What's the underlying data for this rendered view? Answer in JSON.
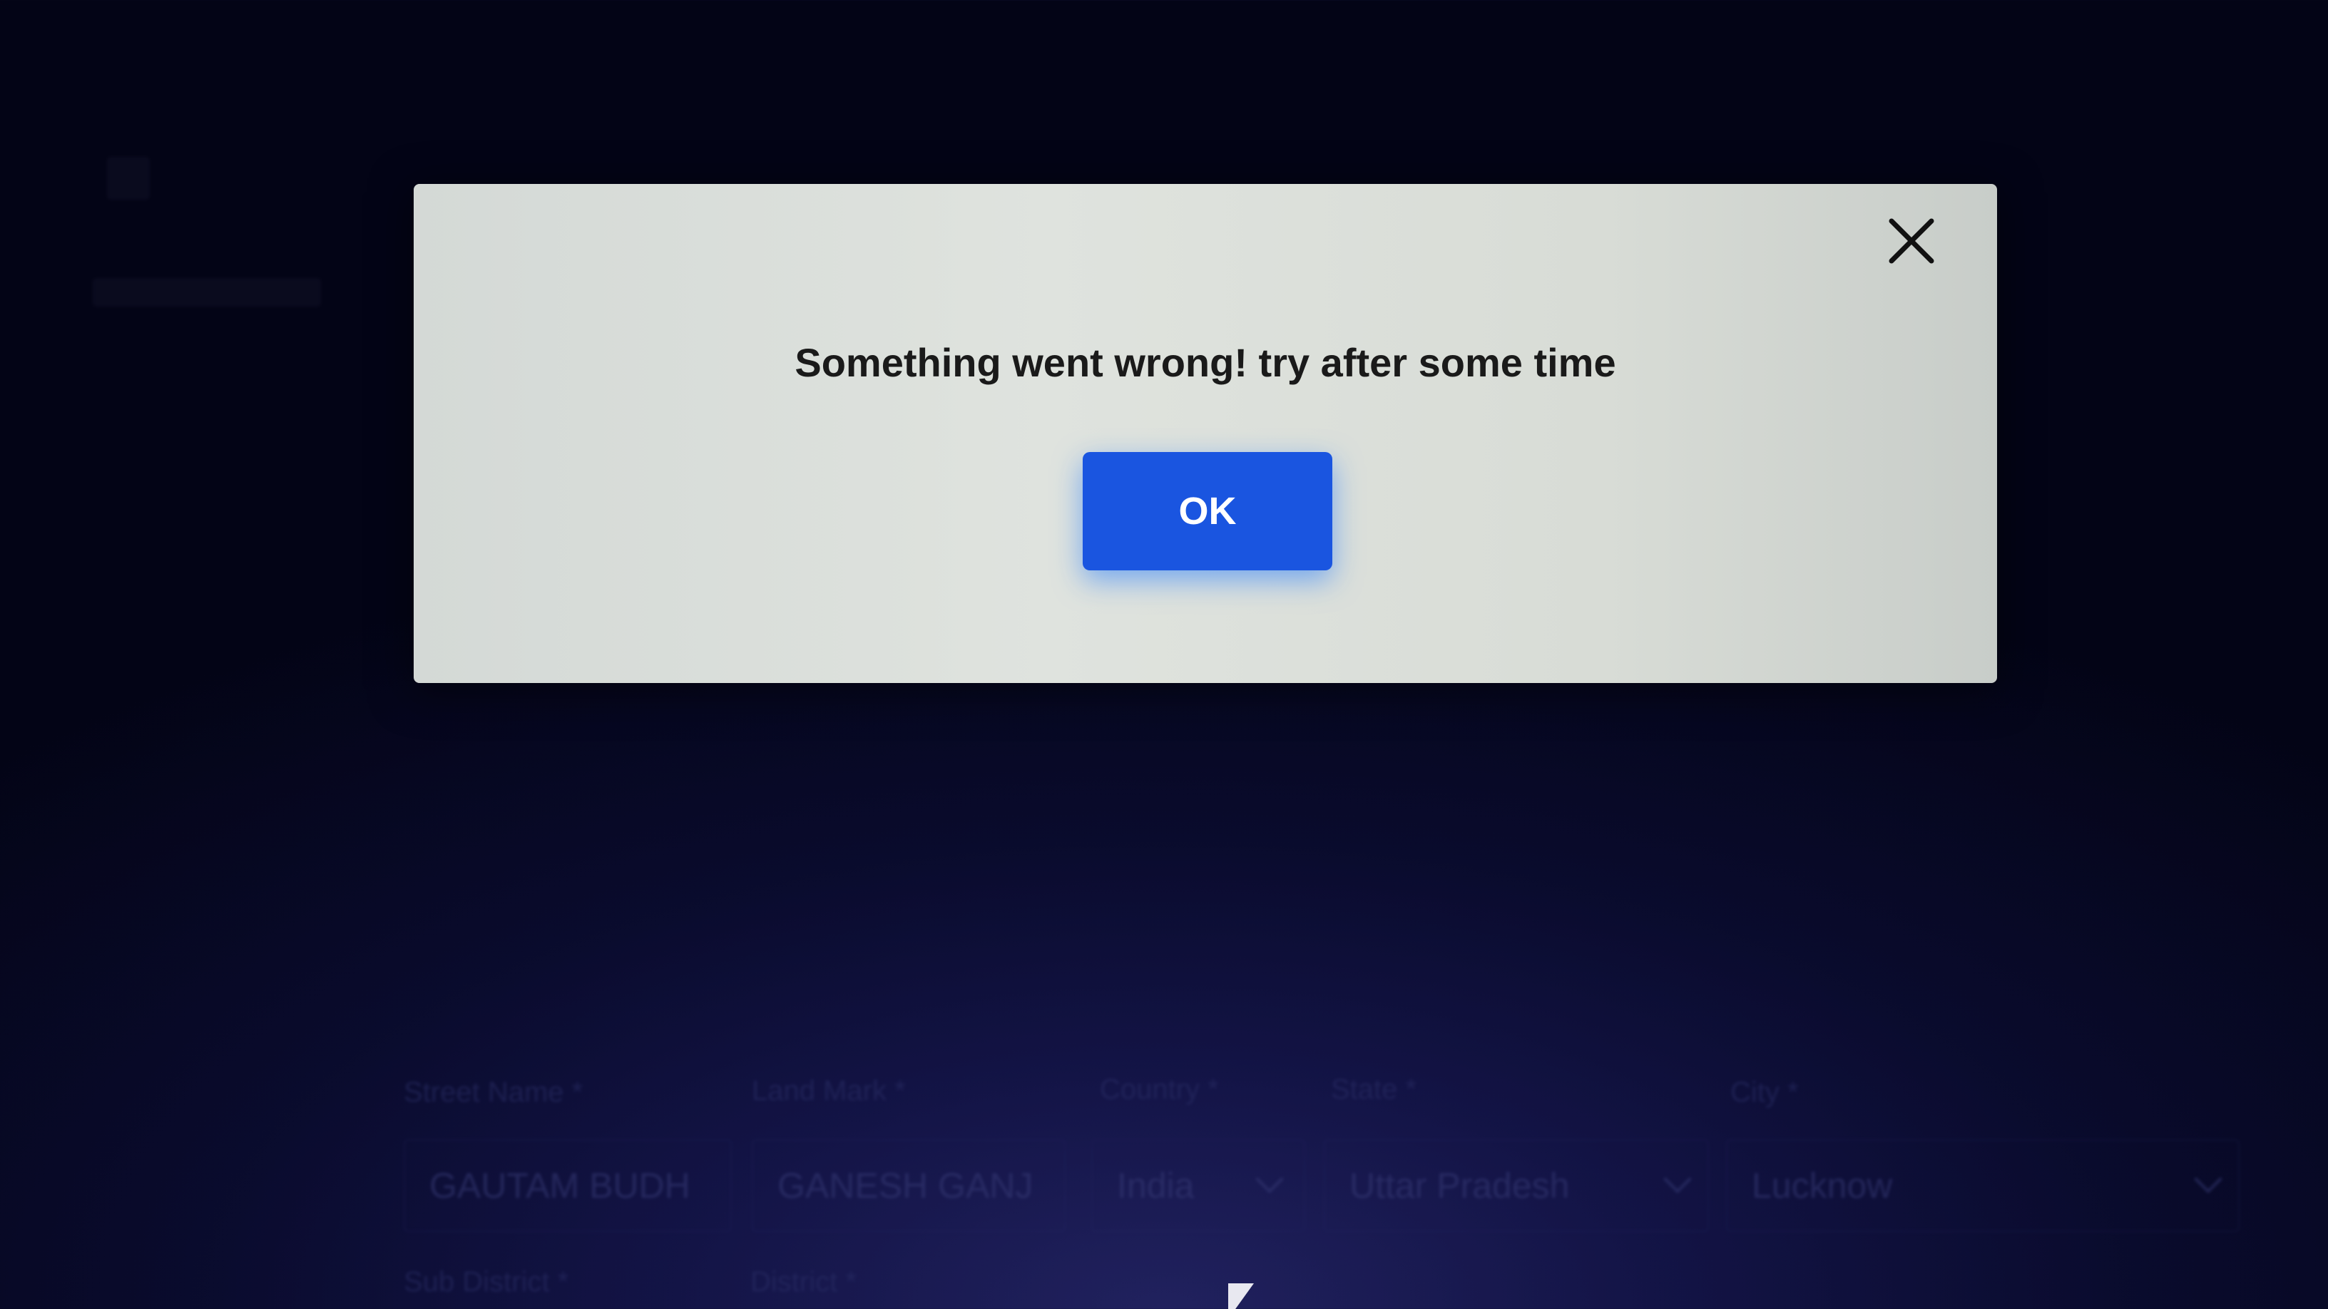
{
  "form": {
    "fields": [
      {
        "label": "Street Name *",
        "value": "GAUTAM BUDH"
      },
      {
        "label": "Land Mark *",
        "value": "GANESH GANJ"
      },
      {
        "label": "Country *",
        "value": "India"
      },
      {
        "label": "State *",
        "value": "Uttar Pradesh"
      },
      {
        "label": "City *",
        "value": "Lucknow"
      }
    ],
    "row2_labels": [
      "Sub District *",
      "District *"
    ]
  },
  "dialog": {
    "message": "Something went wrong! try after some time",
    "ok_label": "OK",
    "close_icon": "close-icon"
  },
  "colors": {
    "ok_button": "#1a55e0",
    "dialog_background": "#dcdfdb",
    "page_background": "#0d0f38"
  }
}
